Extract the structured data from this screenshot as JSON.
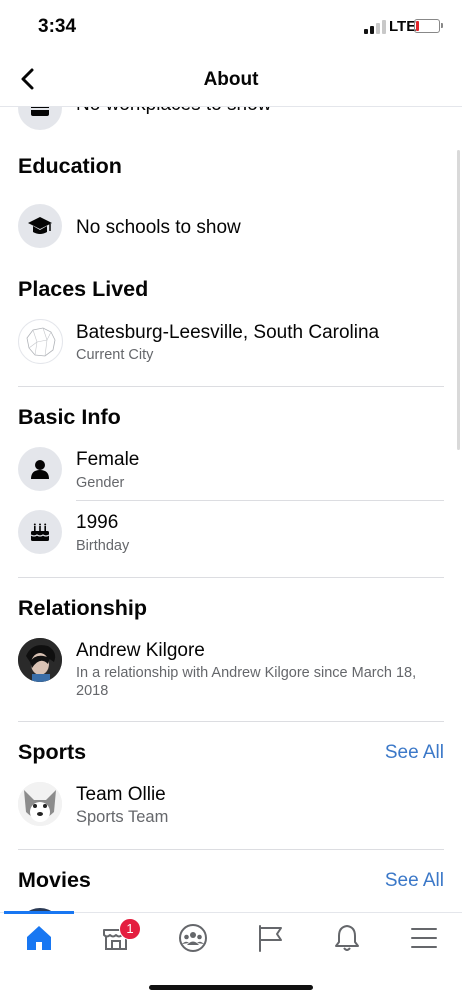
{
  "status_bar": {
    "time": "3:34",
    "network": "LTE"
  },
  "nav": {
    "title": "About"
  },
  "work": {
    "partial_text": "No workplaces to show"
  },
  "education": {
    "title": "Education",
    "value": "No schools to show"
  },
  "places_lived": {
    "title": "Places Lived",
    "city": "Batesburg-Leesville, South Carolina",
    "city_label": "Current City"
  },
  "basic_info": {
    "title": "Basic Info",
    "gender": "Female",
    "gender_label": "Gender",
    "birthday": "1996",
    "birthday_label": "Birthday"
  },
  "relationship": {
    "title": "Relationship",
    "name": "Andrew Kilgore",
    "detail": "In a relationship with Andrew Kilgore since March 18, 2018"
  },
  "sports": {
    "title": "Sports",
    "see_all": "See All",
    "team": "Team Ollie",
    "team_label": "Sports Team"
  },
  "movies": {
    "title": "Movies",
    "see_all": "See All"
  },
  "tab_bar": {
    "marketplace_badge": "1"
  },
  "colors": {
    "accent": "#1877f2",
    "link": "#3b78c8",
    "badge": "#e41e3f",
    "secondary_text": "#65676b"
  }
}
